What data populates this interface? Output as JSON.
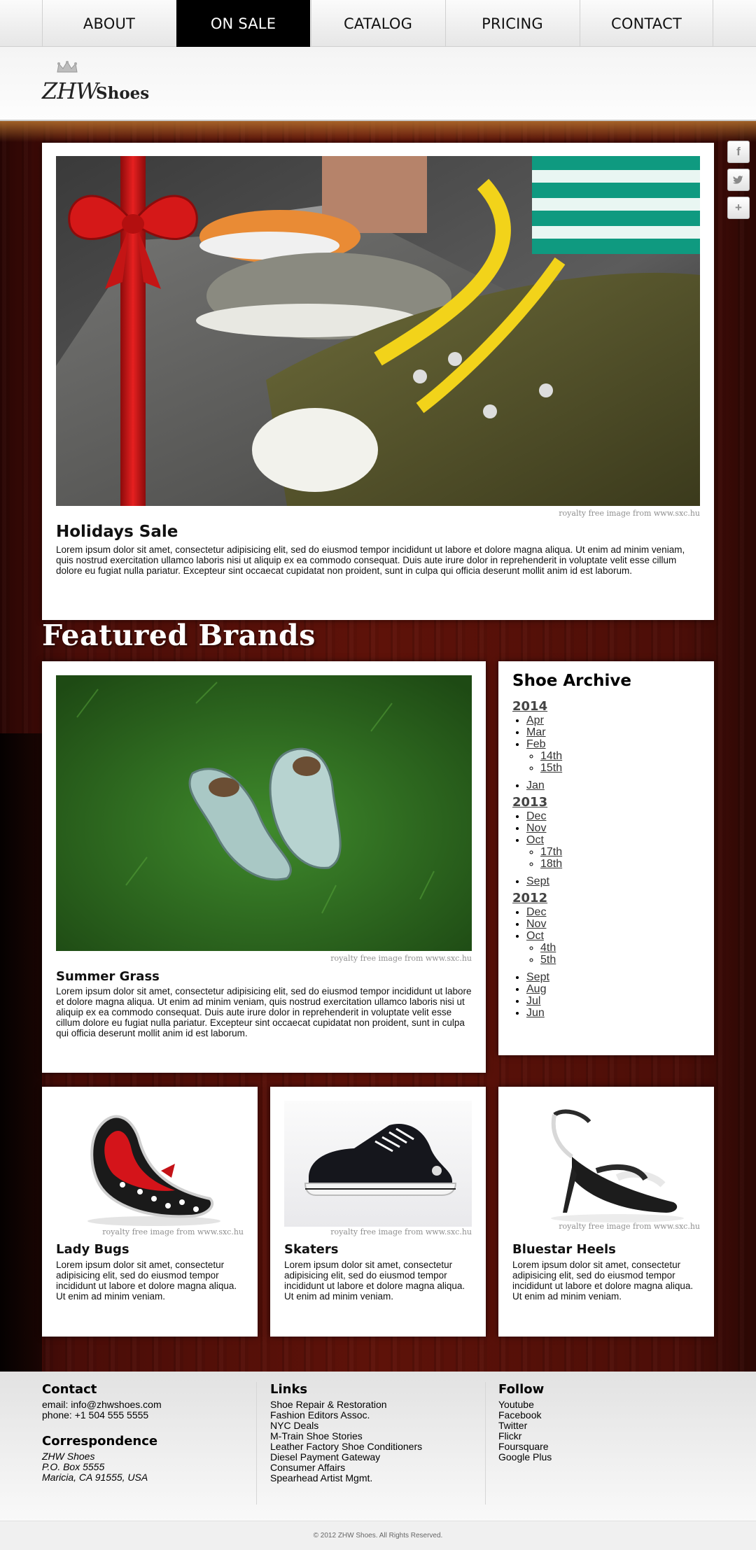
{
  "nav": {
    "items": [
      {
        "label": "ABOUT"
      },
      {
        "label": "ON SALE"
      },
      {
        "label": "CATALOG"
      },
      {
        "label": "PRICING"
      },
      {
        "label": "CONTACT"
      }
    ],
    "active": "ON SALE"
  },
  "logo": {
    "zhw": "ZHW",
    "shoes": "Shoes"
  },
  "social": {
    "facebook": "f",
    "twitter": "t",
    "plus": "+"
  },
  "hero": {
    "credit": "royalty free image from www.sxc.hu",
    "title": "Holidays Sale",
    "text": "Lorem ipsum dolor sit amet, consectetur adipisicing elit, sed do eiusmod tempor incididunt ut labore et dolore magna aliqua. Ut enim ad minim veniam, quis nostrud exercitation ullamco laboris nisi ut aliquip ex ea commodo consequat. Duis aute irure dolor in reprehenderit in voluptate velit esse cillum dolore eu fugiat nulla pariatur. Excepteur sint occaecat cupidatat non proident, sunt in culpa qui officia deserunt mollit anim id est laborum."
  },
  "featured_heading": "Featured Brands",
  "summer": {
    "credit": "royalty free image from www.sxc.hu",
    "title": "Summer Grass",
    "text": "Lorem ipsum dolor sit amet, consectetur adipisicing elit, sed do eiusmod tempor incididunt ut labore et dolore magna aliqua. Ut enim ad minim veniam, quis nostrud exercitation ullamco laboris nisi ut aliquip ex ea commodo consequat. Duis aute irure dolor in reprehenderit in voluptate velit esse cillum dolore eu fugiat nulla pariatur. Excepteur sint occaecat cupidatat non proident, sunt in culpa qui officia deserunt mollit anim id est laborum."
  },
  "archive": {
    "title": "Shoe Archive",
    "years": [
      {
        "year": "2014",
        "months": [
          {
            "m": "Apr"
          },
          {
            "m": "Mar"
          },
          {
            "m": "Feb",
            "days": [
              "14th",
              "15th"
            ]
          },
          {
            "m": "Jan"
          }
        ]
      },
      {
        "year": "2013",
        "months": [
          {
            "m": "Dec"
          },
          {
            "m": "Nov"
          },
          {
            "m": "Oct",
            "days": [
              "17th",
              "18th"
            ]
          },
          {
            "m": "Sept"
          }
        ]
      },
      {
        "year": "2012",
        "months": [
          {
            "m": "Dec"
          },
          {
            "m": "Nov"
          },
          {
            "m": "Oct",
            "days": [
              "4th",
              "5th"
            ]
          },
          {
            "m": "Sept"
          },
          {
            "m": "Aug"
          },
          {
            "m": "Jul"
          },
          {
            "m": "Jun"
          }
        ]
      }
    ]
  },
  "cards": [
    {
      "title": "Lady Bugs",
      "credit": "royalty free image from www.sxc.hu",
      "text": "Lorem ipsum dolor sit amet, consectetur adipisicing elit, sed do eiusmod tempor incididunt ut labore et dolore magna aliqua. Ut enim ad minim veniam."
    },
    {
      "title": "Skaters",
      "credit": "royalty free image from www.sxc.hu",
      "text": "Lorem ipsum dolor sit amet, consectetur adipisicing elit, sed do eiusmod tempor incididunt ut labore et dolore magna aliqua. Ut enim ad minim veniam."
    },
    {
      "title": "Bluestar Heels",
      "credit": "royalty free image from www.sxc.hu",
      "text": "Lorem ipsum dolor sit amet, consectetur adipisicing elit, sed do eiusmod tempor incididunt ut labore et dolore magna aliqua. Ut enim ad minim veniam."
    }
  ],
  "footer": {
    "contact": {
      "title": "Contact",
      "email": "email: info@zhwshoes.com",
      "phone": "phone: +1 504 555 5555"
    },
    "correspondence": {
      "title": "Correspondence",
      "lines": [
        "ZHW Shoes",
        "P.O. Box 5555",
        "Maricia, CA 91555, USA"
      ]
    },
    "links": {
      "title": "Links",
      "items": [
        "Shoe Repair & Restoration",
        "Fashion Editors Assoc.",
        "NYC Deals",
        "M-Train Shoe Stories",
        "Leather Factory Shoe Conditioners",
        "Diesel Payment Gateway",
        "Consumer Affairs",
        "Spearhead Artist Mgmt."
      ]
    },
    "follow": {
      "title": "Follow",
      "items": [
        "Youtube",
        "Facebook",
        "Twitter",
        "Flickr",
        "Foursquare",
        "Google Plus"
      ]
    },
    "copyright": "© 2012 ZHW Shoes. All Rights Reserved."
  }
}
